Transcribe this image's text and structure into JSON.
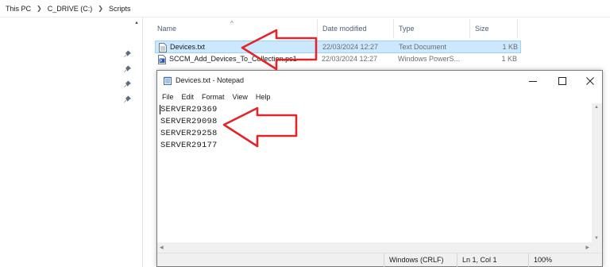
{
  "breadcrumb": [
    "This PC",
    "C_DRIVE (C:)",
    "Scripts"
  ],
  "columns": {
    "name": "Name",
    "date": "Date modified",
    "type": "Type",
    "size": "Size"
  },
  "files": [
    {
      "name": "Devices.txt",
      "date": "22/03/2024 12:27",
      "type": "Text Document",
      "size": "1 KB",
      "icon": "text-file-icon",
      "selected": true
    },
    {
      "name": "SCCM_Add_Devices_To_Collection.ps1",
      "date": "22/03/2024 12:27",
      "type": "Windows PowerS...",
      "size": "1 KB",
      "icon": "powershell-file-icon",
      "selected": false
    }
  ],
  "notepad": {
    "title": "Devices.txt - Notepad",
    "menu": [
      "File",
      "Edit",
      "Format",
      "View",
      "Help"
    ],
    "lines": [
      "SERVER29369",
      "SERVER29098",
      "SERVER29258",
      "SERVER29177"
    ],
    "status": {
      "line_ending": "Windows (CRLF)",
      "position": "Ln 1, Col 1",
      "zoom": "100%"
    }
  },
  "colors": {
    "selection": "#cce8ff",
    "selection_border": "#99d1ff",
    "annotation_arrow": "#e0252b",
    "header_text": "#4c607a"
  },
  "annotations": [
    "arrow-pointing-at-devices-file",
    "arrow-pointing-at-server-list"
  ]
}
